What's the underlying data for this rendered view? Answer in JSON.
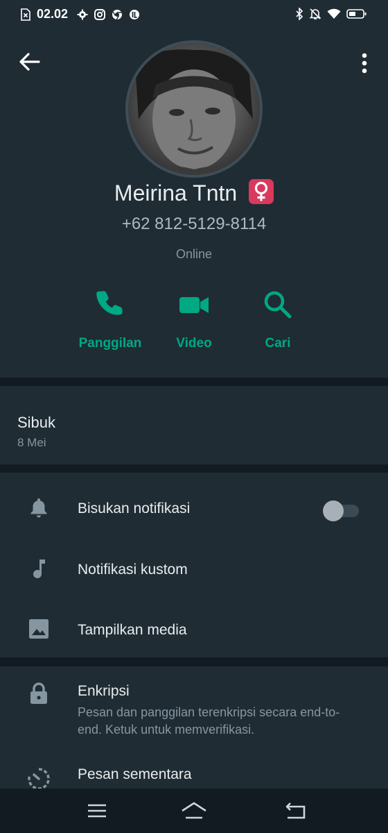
{
  "status_bar": {
    "time": "02.02",
    "left_icons": [
      "sim-error-icon",
      "settings-icon",
      "instagram-icon",
      "chrome-icon",
      "app-icon"
    ],
    "right_icons": [
      "bluetooth-icon",
      "notifications-off-icon",
      "wifi-icon",
      "battery-icon"
    ]
  },
  "contact": {
    "name": "Meirina Tntn",
    "name_emoji": "female-sign-emoji",
    "phone": "+62 812-5129-8114",
    "presence": "Online"
  },
  "actions": [
    {
      "label": "Panggilan",
      "icon": "phone-icon"
    },
    {
      "label": "Video",
      "icon": "video-camera-icon"
    },
    {
      "label": "Cari",
      "icon": "search-icon"
    }
  ],
  "about": {
    "status": "Sibuk",
    "date": "8 Mei"
  },
  "settings": {
    "mute_label": "Bisukan notifikasi",
    "mute_enabled": false,
    "custom_notif_label": "Notifikasi kustom",
    "media_label": "Tampilkan media"
  },
  "security": {
    "encryption_title": "Enkripsi",
    "encryption_desc": "Pesan dan panggilan terenkripsi secara end-to-end. Ketuk untuk memverifikasi.",
    "disappearing_title": "Pesan sementara"
  },
  "colors": {
    "accent": "#00a884",
    "background": "#121b22",
    "panel": "#1f2c34",
    "text_primary": "#e9edef",
    "text_secondary": "#8696a0"
  }
}
